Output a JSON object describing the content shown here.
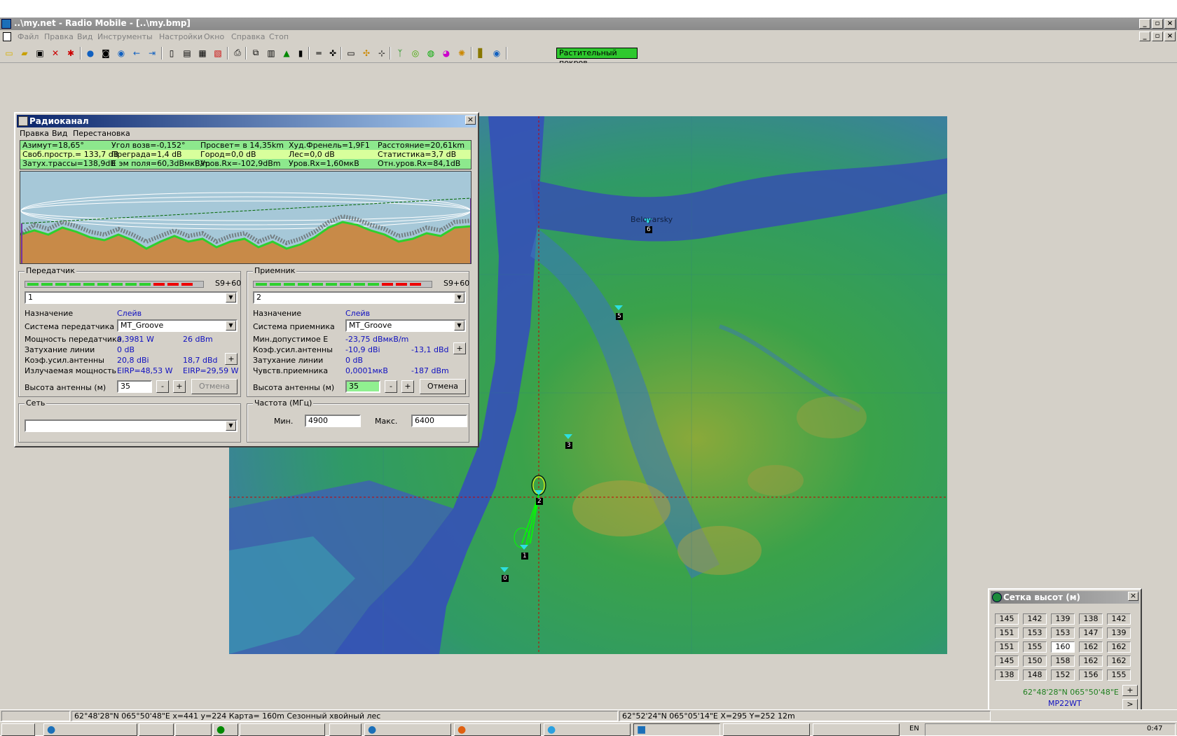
{
  "window": {
    "title": "..\\my.net - Radio Mobile - [..\\my.bmp]"
  },
  "menu": [
    "Файл",
    "Правка",
    "Вид",
    "Инструменты",
    "Настройки",
    "Окно",
    "Справка",
    "Стоп"
  ],
  "toolbar": {
    "vegetation_label": "Растительный покров"
  },
  "map": {
    "units": [
      {
        "id": "0"
      },
      {
        "id": "1"
      },
      {
        "id": "2"
      },
      {
        "id": "3"
      },
      {
        "id": "5"
      },
      {
        "id": "6"
      }
    ],
    "place_label": "Beloyarsky"
  },
  "radiolink": {
    "title": "Радиоканал",
    "menu": [
      "Правка",
      "Вид",
      "Перестановка"
    ],
    "info_rows": [
      [
        "Азимут=18,65°",
        "Угол возв=-0,152°",
        "Просвет= в 14,35km",
        "Худ.Френель=1,9F1",
        "Расстояние=20,61km"
      ],
      [
        "Своб.простр.= 133,7 dB",
        "Преграда=1,4 dB",
        "Город=0,0 dB",
        "Лес=0,0 dB",
        "Статистика=3,7 dB"
      ],
      [
        "Затух.трассы=138,9dB",
        "E эм поля=60,3dBмкВ/m",
        "Уров.Rx=-102,9dBm",
        "Уров.Rx=1,60мкВ",
        "Отн.уров.Rx=84,1dB"
      ]
    ],
    "tx": {
      "legend": "Передатчик",
      "meter_label": "S9+60",
      "unit": "1",
      "role_label": "Назначение",
      "role_value": "Слейв",
      "system_label": "Система передатчика",
      "system_value": "MT_Groove",
      "power_label": "Мощность передатчика",
      "power_w": "0,3981 W",
      "power_dbm": "26 dBm",
      "loss_label": "Затухание линии",
      "loss_value": "0 dB",
      "gain_label": "Коэф.усил.антенны",
      "gain_dbi": "20,8 dBi",
      "gain_dbd": "18,7 dBd",
      "erp_label": "Излучаемая мощность",
      "eirp_w": "EIRP=48,53 W",
      "eirp_dbw": "EIRP=29,59 W",
      "height_label": "Высота антенны (м)",
      "height_value": "35",
      "cancel": "Отмена"
    },
    "rx": {
      "legend": "Приемник",
      "meter_label": "S9+60",
      "unit": "2",
      "role_label": "Назначение",
      "role_value": "Слейв",
      "system_label": "Система приемника",
      "system_value": "MT_Groove",
      "min_e_label": "Мин.допустимое E",
      "min_e_value": "-23,75 dBмкВ/m",
      "gain_label": "Коэф.усил.антенны",
      "gain_dbi": "-10,9 dBi",
      "gain_dbd": "-13,1 dBd",
      "loss_label": "Затухание линии",
      "loss_value": "0 dB",
      "sens_label": "Чувств.приемника",
      "sens_uv": "0,0001мкВ",
      "sens_dbm": "-187 dBm",
      "height_label": "Высота антенны (м)",
      "height_value": "35",
      "cancel": "Отмена"
    },
    "net": {
      "legend": "Сеть",
      "value": ""
    },
    "freq": {
      "legend": "Частота (МГц)",
      "min_label": "Мин.",
      "min_value": "4900",
      "max_label": "Макс.",
      "max_value": "6400"
    }
  },
  "elevation": {
    "title": "Сетка высот (м)",
    "grid": [
      [
        "145",
        "142",
        "139",
        "138",
        "142"
      ],
      [
        "151",
        "153",
        "153",
        "147",
        "139"
      ],
      [
        "151",
        "155",
        "160",
        "162",
        "162"
      ],
      [
        "145",
        "150",
        "158",
        "162",
        "162"
      ],
      [
        "138",
        "148",
        "152",
        "156",
        "155"
      ]
    ],
    "coords": "62°48'28\"N  065°50'48\"E",
    "locator": "MP22WT",
    "plus": "+",
    "next": ">"
  },
  "statusbar": {
    "left": "62°48'28\"N 065°50'48\"E  x=441 y=224 Карта= 160m Сезонный хвойный лес",
    "right": "62°52'24\"N 065°05'14\"E  X=295 Y=252 12m"
  },
  "taskbar": {
    "lang": "EN",
    "clock": "0:47"
  }
}
